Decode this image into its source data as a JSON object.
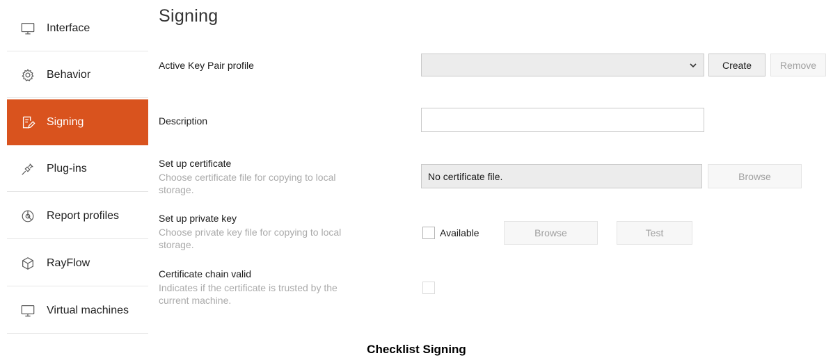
{
  "sidebar": {
    "items": [
      {
        "label": "Interface",
        "icon": "monitor-icon"
      },
      {
        "label": "Behavior",
        "icon": "gear-icon"
      },
      {
        "label": "Signing",
        "icon": "signature-icon",
        "active": true
      },
      {
        "label": "Plug-ins",
        "icon": "plug-icon"
      },
      {
        "label": "Report profiles",
        "icon": "report-icon"
      },
      {
        "label": "RayFlow",
        "icon": "cube-icon"
      },
      {
        "label": "Virtual machines",
        "icon": "monitor-icon"
      }
    ],
    "accent_color": "#d9531e"
  },
  "main": {
    "title": "Signing",
    "key_pair": {
      "label": "Active Key Pair profile",
      "selected_value": "",
      "create_label": "Create",
      "remove_label": "Remove"
    },
    "description": {
      "label": "Description",
      "value": ""
    },
    "certificate": {
      "label": "Set up certificate",
      "help_line1": "Choose certificate file for copying to local",
      "help_line2": "storage.",
      "field_value": "No certificate file.",
      "browse_label": "Browse"
    },
    "private_key": {
      "label": "Set up private key",
      "help_line1": "Choose private key file for copying to local",
      "help_line2": "storage.",
      "available_label": "Available",
      "available_checked": false,
      "browse_label": "Browse",
      "test_label": "Test"
    },
    "chain": {
      "label": "Certificate chain valid",
      "help_line1": "Indicates if the certificate is trusted by the",
      "help_line2": "current machine.",
      "checked": false
    }
  },
  "caption": "Checklist Signing"
}
